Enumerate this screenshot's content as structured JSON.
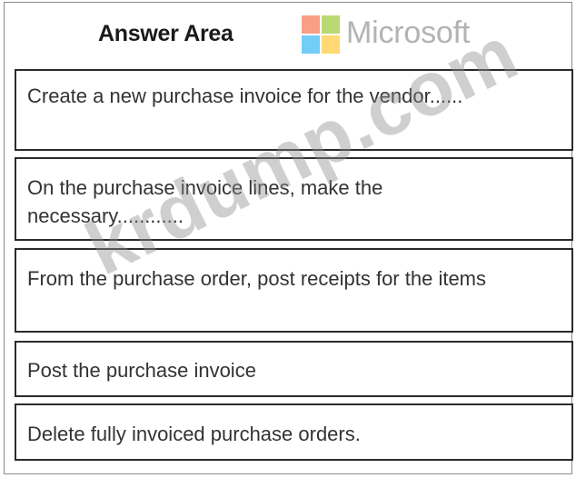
{
  "header": {
    "title": "Answer Area",
    "brand": "Microsoft",
    "brand_logo_colors": [
      "#f25022",
      "#7fba00",
      "#00a4ef",
      "#ffb900"
    ]
  },
  "answer_items": [
    {
      "label": "Create a new purchase invoice for the vendor......"
    },
    {
      "label": "On the purchase invoice lines, make the necessary............"
    },
    {
      "label": "From the purchase order, post receipts for the items"
    },
    {
      "label": "Post the purchase invoice"
    },
    {
      "label": "Delete fully invoiced purchase orders."
    }
  ],
  "watermark": "krdump.com"
}
